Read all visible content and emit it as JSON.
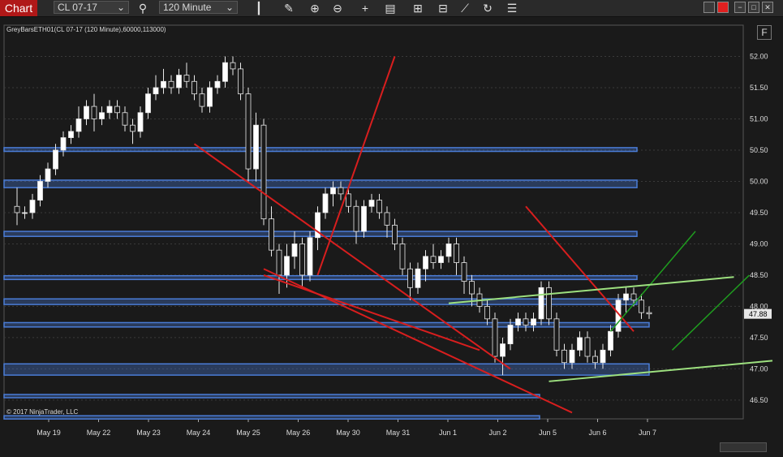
{
  "toolbar": {
    "chart_label": "Chart",
    "instrument": "CL 07-17",
    "interval": "120 Minute",
    "icons": [
      "search-icon",
      "bars-icon",
      "pencil-icon",
      "zoom-in-icon",
      "zoom-out-icon",
      "crosshair-icon",
      "data-box-icon",
      "indicators-icon",
      "strategies-icon",
      "drawing-tools-icon",
      "refresh-icon",
      "properties-icon"
    ]
  },
  "chart": {
    "info_label": "GreyBarsETH01(CL 07-17 (120 Minute),60000,113000)",
    "copyright": "© 2017 NinjaTrader, LLC",
    "scale_button": "F",
    "current_price": "47.88",
    "price_labels": [
      "52.00",
      "51.50",
      "51.00",
      "50.50",
      "50.00",
      "49.50",
      "49.00",
      "48.50",
      "48.00",
      "47.50",
      "47.00",
      "46.50"
    ],
    "date_labels": [
      "May 19",
      "May 22",
      "May 23",
      "May 24",
      "May 25",
      "May 26",
      "May 30",
      "May 31",
      "Jun 1",
      "Jun 2",
      "Jun 5",
      "Jun 6",
      "Jun 7"
    ],
    "colors": {
      "background": "#1a1a1a",
      "bar": "#e8e8e8",
      "zone": "#4a7cd6",
      "red_line": "#d81e1e",
      "green_line": "#1f9d1f",
      "light_green": "#9de07f",
      "price_marker": "#e8e8e8"
    }
  },
  "chart_data": {
    "type": "candlestick",
    "ylim": [
      46.2,
      52.5
    ],
    "price_axis_ticks": [
      52.0,
      51.5,
      51.0,
      50.5,
      50.0,
      49.5,
      49.0,
      48.5,
      48.0,
      47.5,
      47.0,
      46.5
    ],
    "last_price": 47.88,
    "candles": [
      [
        49.6,
        49.9,
        49.3,
        49.5
      ],
      [
        49.5,
        49.6,
        49.4,
        49.5
      ],
      [
        49.5,
        49.8,
        49.4,
        49.7
      ],
      [
        49.7,
        50.1,
        49.6,
        50.0
      ],
      [
        50.0,
        50.3,
        49.9,
        50.2
      ],
      [
        50.2,
        50.6,
        50.1,
        50.5
      ],
      [
        50.5,
        50.8,
        50.4,
        50.7
      ],
      [
        50.7,
        50.9,
        50.6,
        50.8
      ],
      [
        50.8,
        51.2,
        50.7,
        51.0
      ],
      [
        51.0,
        51.3,
        50.9,
        51.2
      ],
      [
        51.2,
        51.4,
        50.8,
        51.0
      ],
      [
        51.0,
        51.2,
        50.9,
        51.1
      ],
      [
        51.1,
        51.3,
        51.0,
        51.2
      ],
      [
        51.2,
        51.3,
        51.0,
        51.1
      ],
      [
        51.1,
        51.2,
        50.8,
        50.9
      ],
      [
        50.9,
        51.0,
        50.6,
        50.8
      ],
      [
        50.8,
        51.2,
        50.7,
        51.1
      ],
      [
        51.1,
        51.5,
        51.0,
        51.4
      ],
      [
        51.4,
        51.7,
        51.3,
        51.5
      ],
      [
        51.5,
        51.8,
        51.4,
        51.6
      ],
      [
        51.6,
        51.7,
        51.4,
        51.5
      ],
      [
        51.5,
        51.8,
        51.4,
        51.7
      ],
      [
        51.7,
        51.9,
        51.5,
        51.6
      ],
      [
        51.6,
        51.7,
        51.3,
        51.4
      ],
      [
        51.4,
        51.5,
        51.1,
        51.2
      ],
      [
        51.2,
        51.6,
        51.1,
        51.5
      ],
      [
        51.5,
        51.7,
        51.4,
        51.6
      ],
      [
        51.6,
        52.0,
        51.5,
        51.9
      ],
      [
        51.9,
        52.0,
        51.7,
        51.8
      ],
      [
        51.8,
        51.9,
        51.3,
        51.4
      ],
      [
        51.4,
        51.5,
        50.0,
        50.2
      ],
      [
        50.2,
        51.1,
        50.0,
        50.9
      ],
      [
        50.9,
        51.0,
        49.3,
        49.4
      ],
      [
        49.4,
        49.6,
        48.8,
        48.9
      ],
      [
        48.9,
        49.0,
        48.2,
        48.5
      ],
      [
        48.5,
        49.0,
        48.3,
        48.8
      ],
      [
        48.8,
        49.2,
        48.6,
        49.0
      ],
      [
        49.0,
        49.1,
        48.3,
        48.5
      ],
      [
        48.5,
        49.2,
        48.4,
        49.1
      ],
      [
        49.1,
        49.6,
        48.9,
        49.5
      ],
      [
        49.5,
        49.9,
        49.4,
        49.8
      ],
      [
        49.8,
        50.0,
        49.6,
        49.9
      ],
      [
        49.9,
        50.0,
        49.7,
        49.8
      ],
      [
        49.8,
        49.9,
        49.5,
        49.6
      ],
      [
        49.6,
        49.7,
        49.0,
        49.2
      ],
      [
        49.2,
        49.7,
        49.1,
        49.6
      ],
      [
        49.6,
        49.8,
        49.5,
        49.7
      ],
      [
        49.7,
        49.8,
        49.4,
        49.5
      ],
      [
        49.5,
        49.6,
        49.1,
        49.3
      ],
      [
        49.3,
        49.4,
        48.9,
        49.0
      ],
      [
        49.0,
        49.1,
        48.5,
        48.6
      ],
      [
        48.6,
        48.7,
        48.1,
        48.3
      ],
      [
        48.3,
        48.7,
        48.2,
        48.6
      ],
      [
        48.6,
        48.9,
        48.4,
        48.8
      ],
      [
        48.8,
        49.0,
        48.6,
        48.7
      ],
      [
        48.7,
        48.9,
        48.6,
        48.8
      ],
      [
        48.8,
        49.1,
        48.7,
        49.0
      ],
      [
        49.0,
        49.1,
        48.5,
        48.7
      ],
      [
        48.7,
        48.8,
        48.2,
        48.4
      ],
      [
        48.4,
        48.5,
        48.0,
        48.2
      ],
      [
        48.2,
        48.3,
        47.9,
        48.0
      ],
      [
        48.0,
        48.1,
        47.7,
        47.8
      ],
      [
        47.8,
        47.9,
        47.1,
        47.2
      ],
      [
        47.2,
        47.5,
        46.9,
        47.4
      ],
      [
        47.4,
        47.8,
        47.3,
        47.7
      ],
      [
        47.7,
        47.9,
        47.6,
        47.8
      ],
      [
        47.8,
        47.9,
        47.6,
        47.7
      ],
      [
        47.7,
        47.9,
        47.6,
        47.8
      ],
      [
        47.8,
        48.4,
        47.7,
        48.3
      ],
      [
        48.3,
        48.4,
        47.7,
        47.8
      ],
      [
        47.8,
        47.9,
        47.2,
        47.3
      ],
      [
        47.3,
        47.4,
        47.0,
        47.1
      ],
      [
        47.1,
        47.4,
        47.0,
        47.3
      ],
      [
        47.3,
        47.6,
        47.2,
        47.5
      ],
      [
        47.5,
        47.6,
        47.1,
        47.2
      ],
      [
        47.2,
        47.3,
        47.0,
        47.1
      ],
      [
        47.1,
        47.4,
        47.0,
        47.3
      ],
      [
        47.3,
        47.7,
        47.2,
        47.6
      ],
      [
        47.6,
        48.2,
        47.5,
        48.1
      ],
      [
        48.1,
        48.3,
        47.9,
        48.2
      ],
      [
        48.2,
        48.3,
        48.0,
        48.1
      ],
      [
        48.1,
        48.2,
        47.8,
        47.9
      ],
      [
        47.9,
        48.0,
        47.8,
        47.88
      ]
    ],
    "zones": [
      [
        50.48,
        50.54
      ],
      [
        49.9,
        50.02
      ],
      [
        49.12,
        49.2
      ],
      [
        48.43,
        48.49
      ],
      [
        48.03,
        48.12
      ],
      [
        47.67,
        47.74
      ],
      [
        46.9,
        47.08
      ],
      [
        46.55,
        46.59
      ],
      [
        46.21,
        46.25
      ]
    ],
    "red_lines": [
      [
        [
          49.0,
          52.0
        ],
        [
          39.0,
          48.5
        ]
      ],
      [
        [
          32.0,
          48.5
        ],
        [
          60.0,
          47.3
        ]
      ],
      [
        [
          23.0,
          50.6
        ],
        [
          64.0,
          47.0
        ]
      ],
      [
        [
          32.0,
          48.6
        ],
        [
          72.0,
          46.3
        ]
      ],
      [
        [
          66.0,
          49.6
        ],
        [
          80.0,
          47.6
        ]
      ]
    ],
    "green_lines": [
      [
        [
          77.0,
          47.6
        ],
        [
          88.0,
          49.2
        ]
      ],
      [
        [
          85.0,
          47.3
        ],
        [
          95.0,
          48.5
        ]
      ]
    ],
    "light_green_lines": [
      [
        [
          56.0,
          48.05
        ],
        [
          93.0,
          48.47
        ]
      ],
      [
        [
          69.0,
          46.8
        ],
        [
          98.0,
          47.13
        ]
      ]
    ]
  }
}
